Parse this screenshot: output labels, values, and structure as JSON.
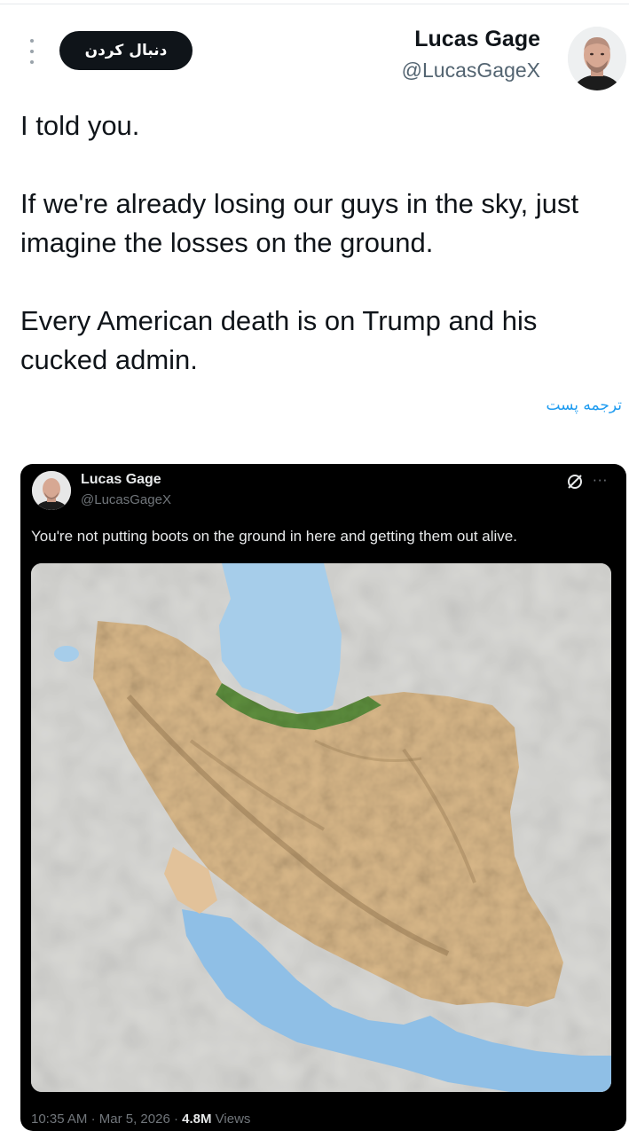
{
  "author": {
    "name": "Lucas Gage",
    "handle": "@LucasGageX",
    "avatar_icon": "avatar-photo"
  },
  "header": {
    "follow_label": "دنبال کردن",
    "more_icon": "vertical-ellipsis-icon"
  },
  "tweet": {
    "paragraphs": [
      "I told you.",
      "If we're already losing our guys in the sky, just imagine the losses on the ground.",
      "Every American death is on Trump and his cucked admin."
    ],
    "translate_label": "ترجمه پست"
  },
  "embedded_post": {
    "name": "Lucas Gage",
    "handle": "@LucasGageX",
    "text": "You're not putting boots on the ground in here and getting them out alive.",
    "time": "10:35 AM",
    "date": "Mar 5, 2026",
    "views_count": "4.8M",
    "views_label": "Views",
    "separator": "·",
    "more_dots": "···",
    "grok_icon": "grok-slash-circle-icon",
    "image": "shaded-relief-terrain-map"
  },
  "colors": {
    "follow_bg": "#0f1419",
    "link": "#1d9bf0",
    "dark_card": "#000000",
    "water": "#a6cdea",
    "desert": "#d9b889",
    "forest": "#5e8f3e"
  }
}
